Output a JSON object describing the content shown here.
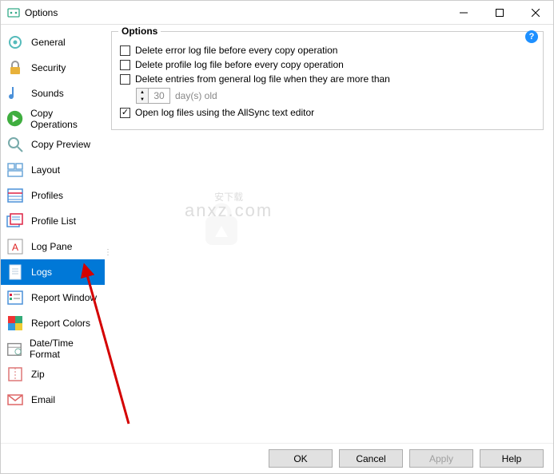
{
  "window": {
    "title": "Options"
  },
  "sidebar": {
    "items": [
      {
        "label": "General"
      },
      {
        "label": "Security"
      },
      {
        "label": "Sounds"
      },
      {
        "label": "Copy Operations"
      },
      {
        "label": "Copy Preview"
      },
      {
        "label": "Layout"
      },
      {
        "label": "Profiles"
      },
      {
        "label": "Profile List"
      },
      {
        "label": "Log Pane"
      },
      {
        "label": "Logs"
      },
      {
        "label": "Report Window"
      },
      {
        "label": "Report Colors"
      },
      {
        "label": "Date/Time Format"
      },
      {
        "label": "Zip"
      },
      {
        "label": "Email"
      }
    ],
    "selected_index": 9
  },
  "panel": {
    "title": "Options",
    "help": "?",
    "opt_delete_error": "Delete error log file before every copy operation",
    "opt_delete_profile": "Delete profile log file before every copy operation",
    "opt_delete_entries": "Delete entries from general log file when they are more than",
    "days_value": "30",
    "days_unit": "day(s) old",
    "opt_open_log": "Open log files using the AllSync text editor"
  },
  "buttons": {
    "ok": "OK",
    "cancel": "Cancel",
    "apply": "Apply",
    "help": "Help"
  },
  "watermark": {
    "name": "安下载",
    "domain": "anxz.com"
  }
}
